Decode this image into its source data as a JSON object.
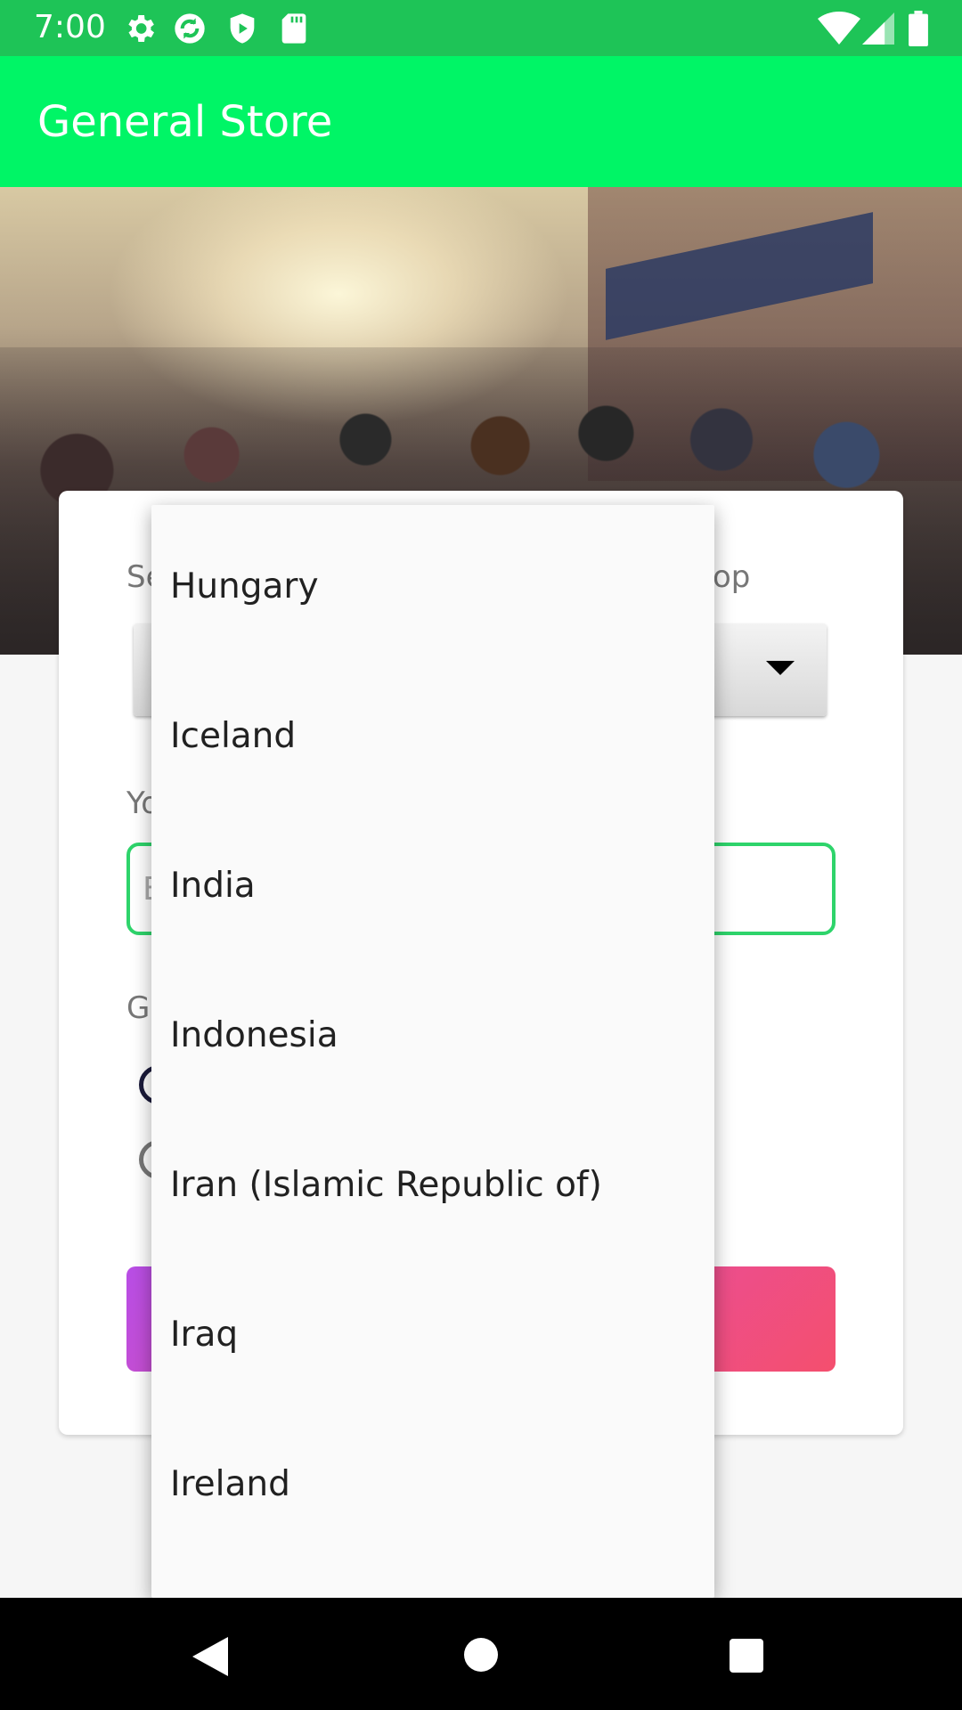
{
  "status_bar": {
    "time": "7:00",
    "left_icons": [
      "gear-icon",
      "sync-icon",
      "play-protect-icon",
      "sd-card-icon"
    ],
    "right_icons": [
      "wifi-icon",
      "cell-signal-icon",
      "battery-icon"
    ]
  },
  "app_bar": {
    "title": "General Store"
  },
  "form": {
    "country_label_partial_left": "Se",
    "country_label_partial_right": "op",
    "name_label_partial": "Yo",
    "name_placeholder_partial": "E",
    "gender_label_partial": "Ge"
  },
  "dropdown": {
    "items": [
      {
        "label": "Hungary"
      },
      {
        "label": "Iceland"
      },
      {
        "label": "India"
      },
      {
        "label": "Indonesia"
      },
      {
        "label": "Iran (Islamic Republic of)"
      },
      {
        "label": "Iraq"
      },
      {
        "label": "Ireland"
      }
    ]
  },
  "colors": {
    "status_bar": "#1ec457",
    "app_bar": "#00f566",
    "input_border": "#2ed46b",
    "button_gradient_start": "#b84ee6",
    "button_gradient_end": "#f44f6e"
  }
}
